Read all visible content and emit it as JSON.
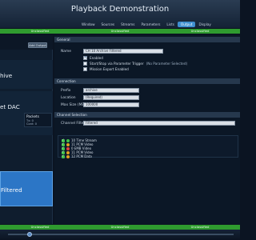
{
  "header": {
    "title": "Playback Demonstration",
    "tabs": [
      {
        "label": "Window",
        "active": false
      },
      {
        "label": "Sources",
        "active": false
      },
      {
        "label": "Streams",
        "active": false
      },
      {
        "label": "Parameters",
        "active": false
      },
      {
        "label": "Lists",
        "active": false
      },
      {
        "label": "Output",
        "active": true
      },
      {
        "label": "Display",
        "active": false
      }
    ]
  },
  "status_top": [
    "Unclassified",
    "Unclassified",
    "Unclassified"
  ],
  "status_bottom": [
    "Unclassified",
    "Unclassified",
    "Unclassified"
  ],
  "left": {
    "add_output_label": "Add Output",
    "outputs": [
      {
        "label": "hive"
      },
      {
        "label": "et DAC"
      },
      {
        "label": "Filtered",
        "selected": true
      }
    ],
    "packets": {
      "header": "Packets",
      "rows": [
        "Tx: 0",
        "Cont: 0"
      ]
    }
  },
  "general": {
    "section": "General",
    "name_label": "Name",
    "name_value": "CH 10 Archive Filtered",
    "enabled_label": "Enabled",
    "enabled": true,
    "start_stop_label": "Start/Stop via Parameter Trigger",
    "start_stop_hint": "(No Parameter Selected)",
    "mission_export_label": "Mission Export Enabled"
  },
  "connection": {
    "section": "Connection",
    "prefix_label": "Prefix",
    "prefix_value": "archive",
    "location_label": "Location",
    "location_value": "(Required)",
    "max_size_label": "Max Size (MB)",
    "max_size_value": "100000"
  },
  "channel_selection": {
    "section": "Channel Selection",
    "filter_label": "Channel Filter",
    "filter_value": "Filtered",
    "items": [
      {
        "label": "10  Time Stream",
        "color": "#3fc04a"
      },
      {
        "label": "11  PCM Video",
        "color": "#e0a020"
      },
      {
        "label": "0  EMB Video",
        "color": "#e04040"
      },
      {
        "label": "11  PCM Video",
        "color": "#e0a020"
      },
      {
        "label": "12  PCM Data",
        "color": "#e0a020"
      }
    ]
  },
  "colors": {
    "accent": "#3f8fd0",
    "status_green": "#2f9b2f",
    "selected_card": "#2c76c6"
  }
}
